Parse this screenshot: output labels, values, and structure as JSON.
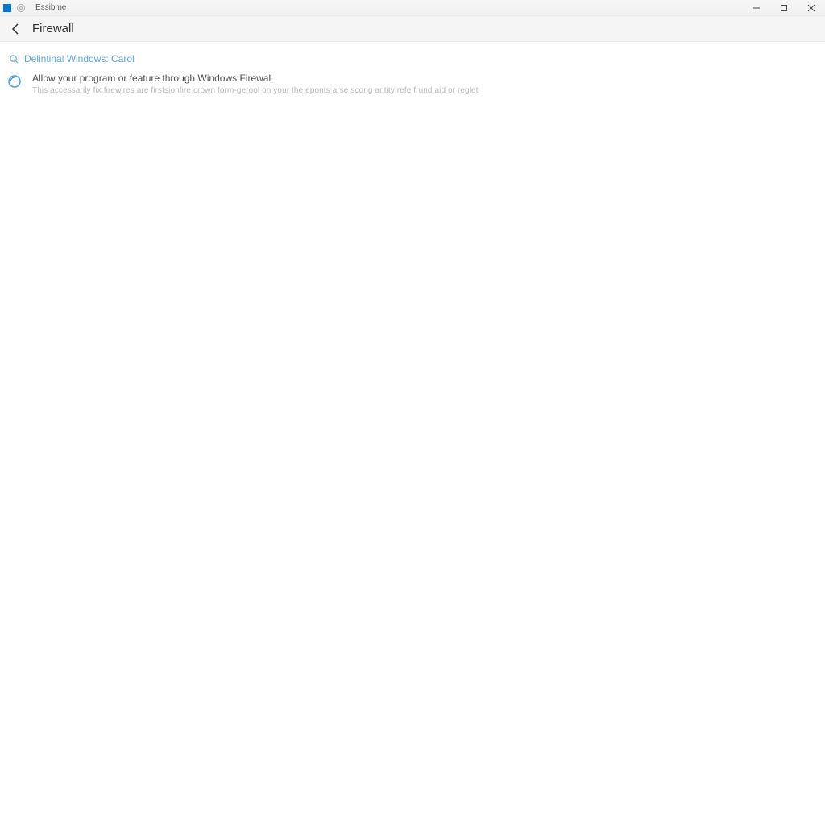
{
  "titlebar": {
    "app_name": "Essibme"
  },
  "header": {
    "title": "Firewall"
  },
  "link": {
    "label": "Delintinal Windows: Carol"
  },
  "section": {
    "title": "Allow your program or feature through Windows Firewall",
    "description": "This accessarily fix firewires are firstsionfire crown form-gerool on your the eponts arse scong antity refe frund aid or reglet"
  }
}
